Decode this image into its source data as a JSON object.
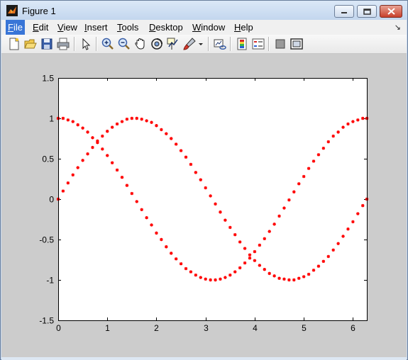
{
  "window": {
    "title": "Figure 1",
    "icon": "matlab-logo-icon"
  },
  "title_buttons": [
    "minimize-icon",
    "maximize-icon",
    "close-icon"
  ],
  "menu": {
    "items": [
      {
        "label": "File",
        "mnemonic": "F",
        "rest": "ile",
        "active": true
      },
      {
        "label": "Edit",
        "mnemonic": "E",
        "rest": "dit"
      },
      {
        "label": "View",
        "mnemonic": "V",
        "rest": "iew"
      },
      {
        "label": "Insert",
        "mnemonic": "I",
        "rest": "nsert"
      },
      {
        "label": "Tools",
        "mnemonic": "T",
        "rest": "ools"
      },
      {
        "label": "Desktop",
        "mnemonic": "D",
        "rest": "esktop"
      },
      {
        "label": "Window",
        "mnemonic": "W",
        "rest": "indow"
      },
      {
        "label": "Help",
        "mnemonic": "H",
        "rest": "elp"
      }
    ],
    "dock_arrow": "↘"
  },
  "toolbar": {
    "buttons": [
      "new-figure-icon",
      "open-file-icon",
      "save-figure-icon",
      "print-figure-icon",
      "edit-plot-icon",
      "zoom-in-icon",
      "zoom-out-icon",
      "pan-icon",
      "rotate-3d-icon",
      "data-cursor-icon",
      "brush-icon",
      "brush-dropdown-icon",
      "link-plot-icon",
      "insert-colorbar-icon",
      "insert-legend-icon",
      "hide-plot-tools-icon",
      "show-plot-tools-icon"
    ]
  },
  "colors": {
    "series": "#ff0000",
    "plot_bg": "#ffffff",
    "figure_bg": "#cccccc"
  },
  "chart_data": {
    "type": "scatter",
    "title": "",
    "xlabel": "",
    "ylabel": "",
    "xlim": [
      0,
      6.2832
    ],
    "ylim": [
      -1.5,
      1.5
    ],
    "xticks": [
      "0",
      "1",
      "2",
      "3",
      "4",
      "5",
      "6"
    ],
    "yticks": [
      "1.5",
      "1",
      "0.5",
      "0",
      "-0.5",
      "-1",
      "-1.5"
    ],
    "xtick_values": [
      0,
      1,
      2,
      3,
      4,
      5,
      6
    ],
    "ytick_values": [
      1.5,
      1,
      0.5,
      0,
      -0.5,
      -1,
      -1.5
    ],
    "marker": "*",
    "grid": false,
    "series": [
      {
        "color": "#ff0000",
        "x": [
          0,
          0.1,
          0.2,
          0.3,
          0.4,
          0.5,
          0.6,
          0.7,
          0.8,
          0.9,
          1.0,
          1.1,
          1.2,
          1.3,
          1.4,
          1.5,
          1.6,
          1.7,
          1.8,
          1.9,
          2.0,
          2.1,
          2.2,
          2.3,
          2.4,
          2.5,
          2.6,
          2.7,
          2.8,
          2.9,
          3.0,
          3.1,
          3.2,
          3.3,
          3.4,
          3.5,
          3.6,
          3.7,
          3.8,
          3.9,
          4.0,
          4.1,
          4.2,
          4.3,
          4.4,
          4.5,
          4.6,
          4.7,
          4.8,
          4.9,
          5.0,
          5.1,
          5.2,
          5.3,
          5.4,
          5.5,
          5.6,
          5.7,
          5.8,
          5.9,
          6.0,
          6.1,
          6.2,
          6.2832
        ],
        "y": [
          0,
          0.1,
          0.2,
          0.3,
          0.39,
          0.48,
          0.56,
          0.64,
          0.72,
          0.78,
          0.84,
          0.89,
          0.93,
          0.96,
          0.99,
          1.0,
          1.0,
          0.99,
          0.97,
          0.95,
          0.91,
          0.86,
          0.81,
          0.75,
          0.68,
          0.6,
          0.52,
          0.43,
          0.33,
          0.24,
          0.14,
          0.04,
          -0.06,
          -0.16,
          -0.26,
          -0.35,
          -0.44,
          -0.53,
          -0.61,
          -0.69,
          -0.76,
          -0.82,
          -0.87,
          -0.92,
          -0.95,
          -0.98,
          -0.99,
          -1.0,
          -1.0,
          -0.98,
          -0.96,
          -0.93,
          -0.88,
          -0.83,
          -0.77,
          -0.71,
          -0.63,
          -0.55,
          -0.46,
          -0.37,
          -0.28,
          -0.18,
          -0.08,
          0
        ]
      },
      {
        "color": "#ff0000",
        "x": [
          0,
          0.1,
          0.2,
          0.3,
          0.4,
          0.5,
          0.6,
          0.7,
          0.8,
          0.9,
          1.0,
          1.1,
          1.2,
          1.3,
          1.4,
          1.5,
          1.6,
          1.7,
          1.8,
          1.9,
          2.0,
          2.1,
          2.2,
          2.3,
          2.4,
          2.5,
          2.6,
          2.7,
          2.8,
          2.9,
          3.0,
          3.1,
          3.2,
          3.3,
          3.4,
          3.5,
          3.6,
          3.7,
          3.8,
          3.9,
          4.0,
          4.1,
          4.2,
          4.3,
          4.4,
          4.5,
          4.6,
          4.7,
          4.8,
          4.9,
          5.0,
          5.1,
          5.2,
          5.3,
          5.4,
          5.5,
          5.6,
          5.7,
          5.8,
          5.9,
          6.0,
          6.1,
          6.2,
          6.2832
        ],
        "y": [
          1.0,
          1.0,
          0.98,
          0.96,
          0.92,
          0.88,
          0.83,
          0.76,
          0.7,
          0.62,
          0.54,
          0.45,
          0.36,
          0.27,
          0.17,
          0.07,
          -0.03,
          -0.13,
          -0.23,
          -0.32,
          -0.42,
          -0.5,
          -0.59,
          -0.67,
          -0.74,
          -0.8,
          -0.86,
          -0.9,
          -0.94,
          -0.97,
          -0.99,
          -1.0,
          -1.0,
          -0.99,
          -0.97,
          -0.94,
          -0.9,
          -0.85,
          -0.79,
          -0.73,
          -0.65,
          -0.57,
          -0.49,
          -0.4,
          -0.31,
          -0.21,
          -0.11,
          -0.01,
          0.09,
          0.19,
          0.28,
          0.38,
          0.47,
          0.55,
          0.63,
          0.71,
          0.78,
          0.83,
          0.89,
          0.93,
          0.96,
          0.98,
          1.0,
          1.0
        ]
      }
    ]
  }
}
